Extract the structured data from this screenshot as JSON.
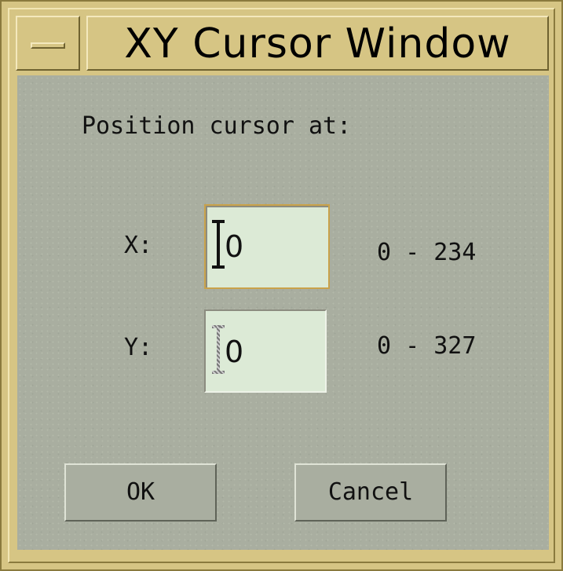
{
  "window": {
    "title": "XY Cursor Window"
  },
  "dialog": {
    "prompt": "Position cursor at:",
    "x": {
      "label": "X:",
      "value": "0",
      "range": "0 - 234"
    },
    "y": {
      "label": "Y:",
      "value": "0",
      "range": "0 - 327"
    }
  },
  "buttons": {
    "ok_label": "OK",
    "cancel_label": "Cancel"
  },
  "icons": {
    "window_menu": "window-menu-icon",
    "text_cursor": "text-cursor-icon"
  },
  "colors": {
    "titlebar": "#d6c584",
    "client_background": "#a9aea0",
    "field_background": "#dcead6",
    "focus_border": "#c9a24a"
  }
}
